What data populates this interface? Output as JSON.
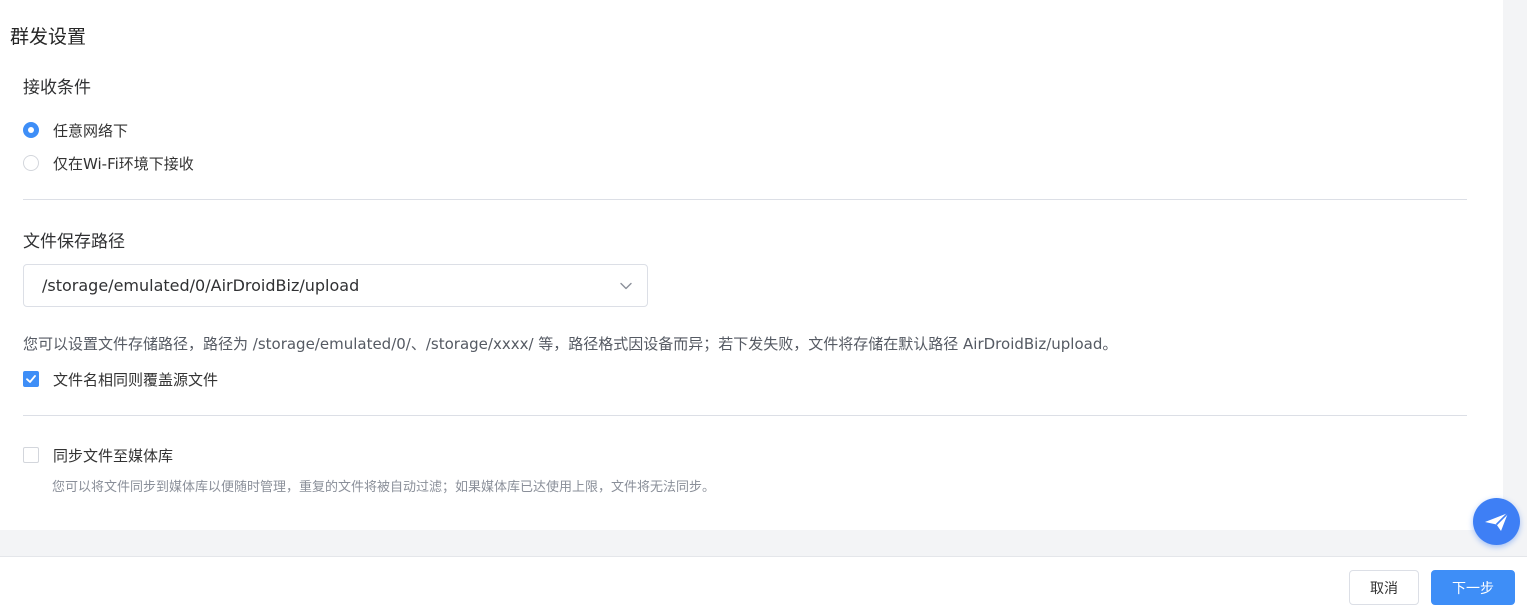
{
  "page": {
    "title": "群发设置"
  },
  "receive_condition": {
    "title": "接收条件",
    "options": [
      {
        "label": "任意网络下",
        "selected": true
      },
      {
        "label": "仅在Wi-Fi环境下接收",
        "selected": false
      }
    ]
  },
  "save_path": {
    "title": "文件保存路径",
    "selected_value": "/storage/emulated/0/AirDroidBiz/upload",
    "hint": "您可以设置文件存储路径，路径为 /storage/emulated/0/、/storage/xxxx/ 等，路径格式因设备而异；若下发失败，文件将存储在默认路径 AirDroidBiz/upload。",
    "overwrite": {
      "label": "文件名相同则覆盖源文件",
      "checked": true
    }
  },
  "media_sync": {
    "label": "同步文件至媒体库",
    "checked": false,
    "hint": "您可以将文件同步到媒体库以便随时管理，重复的文件将被自动过滤；如果媒体库已达使用上限，文件将无法同步。"
  },
  "footer": {
    "cancel_label": "取消",
    "next_label": "下一步"
  },
  "icons": {
    "floating": "send-icon",
    "dropdown": "chevron-down-icon",
    "check": "checkmark-icon"
  },
  "colors": {
    "accent": "#3e8ef7",
    "floating_button": "#3e7ff5",
    "divider": "#dcdfe6"
  }
}
